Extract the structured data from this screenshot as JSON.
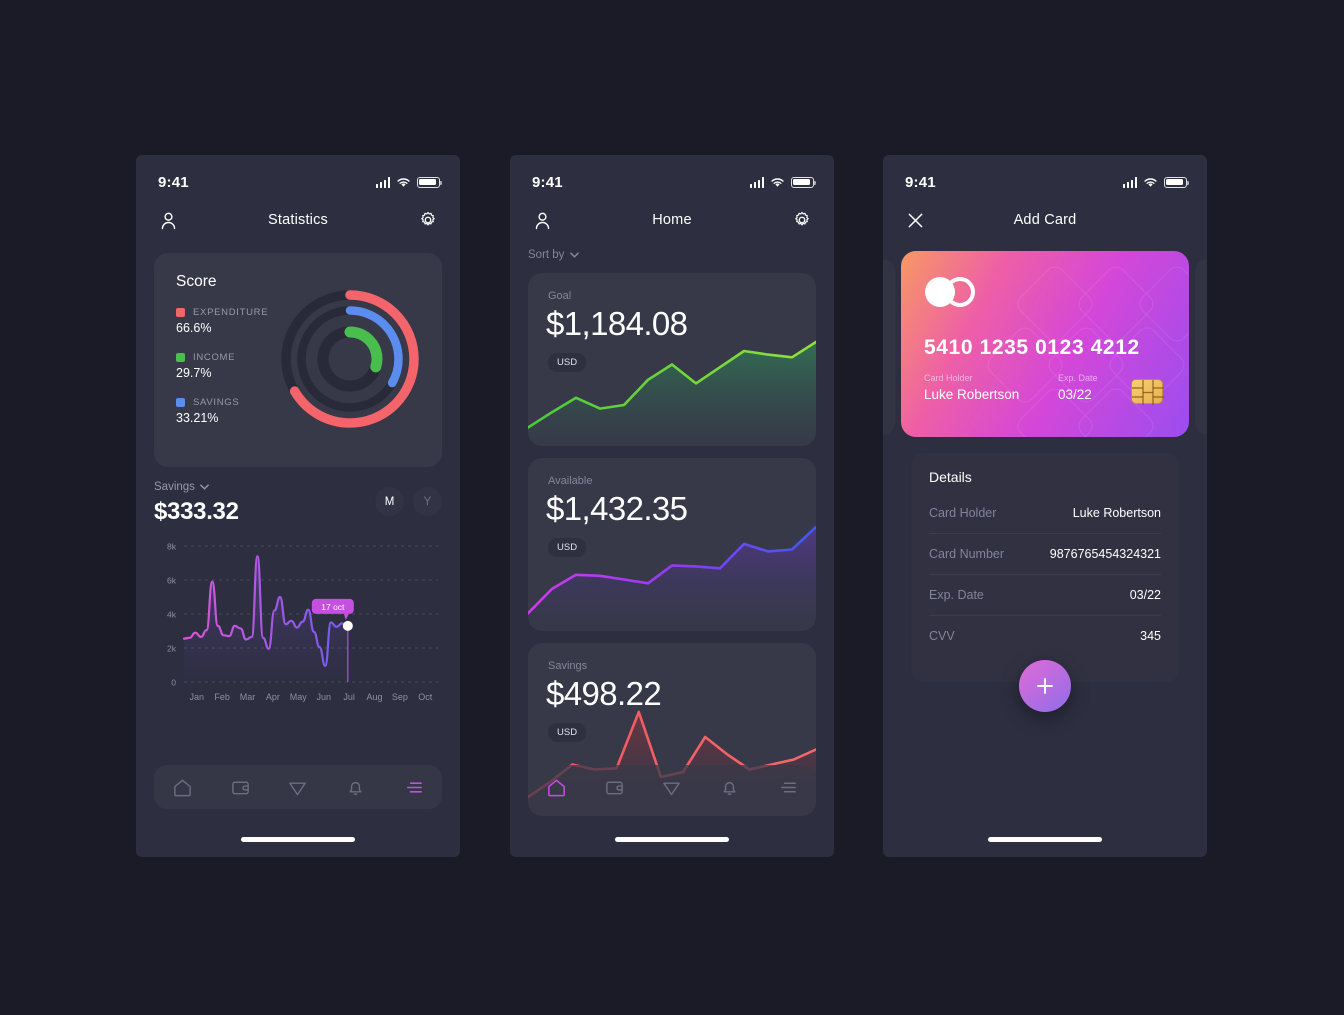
{
  "theme": {
    "page_bg": "#1a1b26",
    "screen_bg": "#2d2e3f",
    "card_bg": "#373848",
    "accent_purple": "#c44fe0",
    "expenditure_color": "#f3656b",
    "income_color": "#49bd4d",
    "savings_color": "#5b8def"
  },
  "status_bar": {
    "time": "9:41",
    "signal_icon": "cellular-bars-icon",
    "wifi_icon": "wifi-icon",
    "battery_icon": "battery-full-icon"
  },
  "screen_statistics": {
    "nav": {
      "left_icon": "user-avatar-icon",
      "title": "Statistics",
      "right_icon": "gear-icon"
    },
    "score": {
      "title": "Score",
      "legend": [
        {
          "label": "EXPENDITURE",
          "value": "66.6%",
          "color": "#f3656b"
        },
        {
          "label": "INCOME",
          "value": "29.7%",
          "color": "#49bd4d"
        },
        {
          "label": "SAVINGS",
          "value": "33.21%",
          "color": "#5b8def"
        }
      ]
    },
    "savings": {
      "label": "Savings",
      "dropdown_icon": "chevron-down-icon",
      "amount": "$333.32",
      "periods": [
        {
          "label": "M",
          "selected": true
        },
        {
          "label": "Y",
          "selected": false
        }
      ]
    },
    "tabbar": [
      {
        "name": "home-icon",
        "active": false
      },
      {
        "name": "wallet-icon",
        "active": false
      },
      {
        "name": "send-icon",
        "active": false
      },
      {
        "name": "bell-icon",
        "active": false
      },
      {
        "name": "statistics-icon",
        "active": true
      }
    ]
  },
  "screen_home": {
    "nav": {
      "left_icon": "user-avatar-icon",
      "title": "Home",
      "right_icon": "gear-icon"
    },
    "sort_by": {
      "label": "Sort by",
      "icon": "chevron-down-icon"
    },
    "cards": [
      {
        "label": "Goal",
        "amount": "$1,184.08",
        "currency": "USD",
        "line_color": "#5ad840"
      },
      {
        "label": "Available",
        "amount": "$1,432.35",
        "currency": "USD",
        "line_color": "#a855f7"
      },
      {
        "label": "Savings",
        "amount": "$498.22",
        "currency": "USD",
        "line_color": "#f0565c"
      }
    ],
    "tabbar": [
      {
        "name": "home-icon",
        "active": true
      },
      {
        "name": "wallet-icon",
        "active": false
      },
      {
        "name": "send-icon",
        "active": false
      },
      {
        "name": "bell-icon",
        "active": false
      },
      {
        "name": "statistics-icon",
        "active": false
      }
    ]
  },
  "screen_add_card": {
    "nav": {
      "left_icon": "close-icon",
      "title": "Add Card",
      "right_icon": ""
    },
    "credit_card": {
      "brand_icon": "mastercard-logo-icon",
      "number": "5410 1235 0123 4212",
      "holder_label": "Card Holder",
      "holder_value": "Luke Robertson",
      "exp_label": "Exp. Date",
      "exp_value": "03/22",
      "chip_icon": "emv-chip-icon"
    },
    "details": {
      "title": "Details",
      "rows": [
        {
          "key": "Card Holder",
          "value": "Luke Robertson"
        },
        {
          "key": "Card Number",
          "value": "9876765454324321"
        },
        {
          "key": "Exp. Date",
          "value": "03/22"
        },
        {
          "key": "CVV",
          "value": "345"
        }
      ]
    },
    "fab": {
      "icon": "plus-icon"
    }
  },
  "chart_data": [
    {
      "type": "pie",
      "title": "Score",
      "subtitle": "Concentric ring gauges",
      "legend_position": "left",
      "rings": [
        {
          "name": "EXPENDITURE",
          "value": 66.6,
          "color": "#f3656b",
          "radius": "outer",
          "track_color": "#282a3a"
        },
        {
          "name": "SAVINGS",
          "value": 33.21,
          "color": "#5b8def",
          "radius": "middle",
          "track_color": "#282a3a"
        },
        {
          "name": "INCOME",
          "value": 29.7,
          "color": "#49bd4d",
          "radius": "inner",
          "track_color": "#282a3a"
        }
      ]
    },
    {
      "type": "area",
      "title": "Savings",
      "headline_value": "$333.32",
      "xlabel": "",
      "ylabel": "",
      "ylim": [
        0,
        8000
      ],
      "ytick_labels": [
        "0",
        "2k",
        "4k",
        "6k",
        "8k"
      ],
      "ytick_values": [
        0,
        2000,
        4000,
        6000,
        8000
      ],
      "grid": true,
      "categories": [
        "Jan",
        "Feb",
        "Mar",
        "Apr",
        "May",
        "Jun",
        "Jul",
        "Aug",
        "Sep",
        "Oct"
      ],
      "line_gradient": [
        "#e254d6",
        "#6d5cf0"
      ],
      "annotation": {
        "label": "17 oct",
        "x_month": "Jul",
        "y_value": 3300,
        "color": "#c44fe0"
      },
      "values": [
        2550,
        2600,
        2900,
        2650,
        3050,
        5900,
        3300,
        2750,
        2700,
        3300,
        3150,
        2500,
        2650,
        7400,
        2600,
        1950,
        4200,
        5000,
        3400,
        3600,
        3200,
        3550,
        4250,
        2950,
        2050,
        950,
        3500,
        3250,
        3450,
        3300
      ]
    },
    {
      "type": "area",
      "title": "Goal",
      "headline_value": "$1,184.08",
      "line_color": "#5ad840",
      "values": [
        5,
        22,
        38,
        26,
        30,
        58,
        75,
        54,
        72,
        90,
        86,
        83,
        100
      ],
      "categories": [
        "1",
        "2",
        "3",
        "4",
        "5",
        "6",
        "7",
        "8",
        "9",
        "10",
        "11",
        "12",
        "13"
      ]
    },
    {
      "type": "area",
      "title": "Available",
      "headline_value": "$1,432.35",
      "line_gradient": [
        "#c23bf0",
        "#3b5bf0"
      ],
      "values": [
        4,
        30,
        45,
        44,
        40,
        36,
        55,
        54,
        52,
        78,
        70,
        72,
        96
      ],
      "categories": [
        "1",
        "2",
        "3",
        "4",
        "5",
        "6",
        "7",
        "8",
        "9",
        "10",
        "11",
        "12",
        "13"
      ]
    },
    {
      "type": "area",
      "title": "Savings",
      "headline_value": "$498.22",
      "line_color": "#f0565c",
      "values": [
        4,
        16,
        30,
        26,
        27,
        72,
        20,
        24,
        52,
        38,
        26,
        30,
        34,
        42
      ],
      "categories": [
        "1",
        "2",
        "3",
        "4",
        "5",
        "6",
        "7",
        "8",
        "9",
        "10",
        "11",
        "12",
        "13",
        "14"
      ]
    }
  ]
}
